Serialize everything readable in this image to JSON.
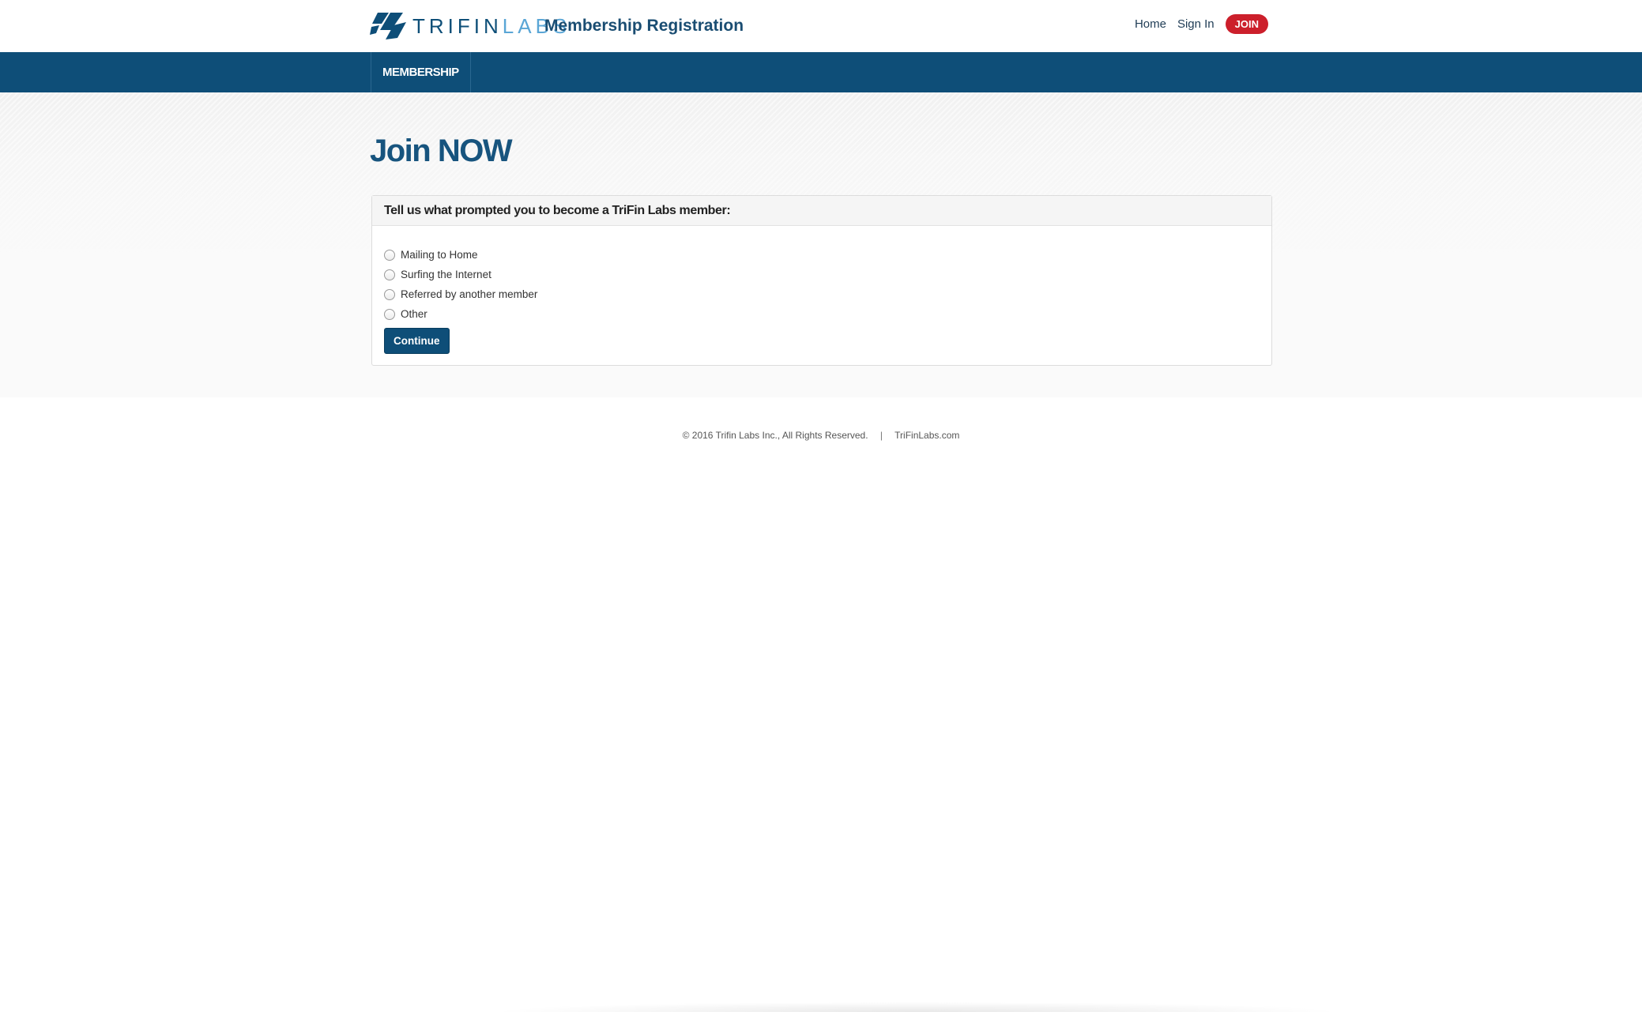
{
  "header": {
    "brand_primary": "TRIFIN",
    "brand_secondary": "LABS",
    "site_title": "Membership Registration",
    "links": [
      {
        "label": "Home"
      },
      {
        "label": "Sign In"
      }
    ],
    "join_label": "JOIN",
    "logo_icon": "trifin-labs-logo-icon"
  },
  "nav": {
    "tabs": [
      {
        "label": "MEMBERSHIP"
      }
    ]
  },
  "main": {
    "title": "Join NOW",
    "panel": {
      "heading": "Tell us what prompted you to become a TriFin Labs member:",
      "options": [
        {
          "label": "Mailing to Home",
          "selected": false
        },
        {
          "label": "Surfing the Internet",
          "selected": false
        },
        {
          "label": "Referred by another member",
          "selected": false
        },
        {
          "label": "Other",
          "selected": false
        }
      ],
      "continue_label": "Continue"
    }
  },
  "footer": {
    "copyright": "© 2016 Trifin Labs Inc., All Rights Reserved.",
    "separator": "|",
    "site_link": "TriFinLabs.com"
  },
  "colors": {
    "brand_dark": "#0e4e78",
    "brand_light": "#5aa6d6",
    "join_red": "#cc1f2b",
    "title_blue": "#17547e"
  }
}
